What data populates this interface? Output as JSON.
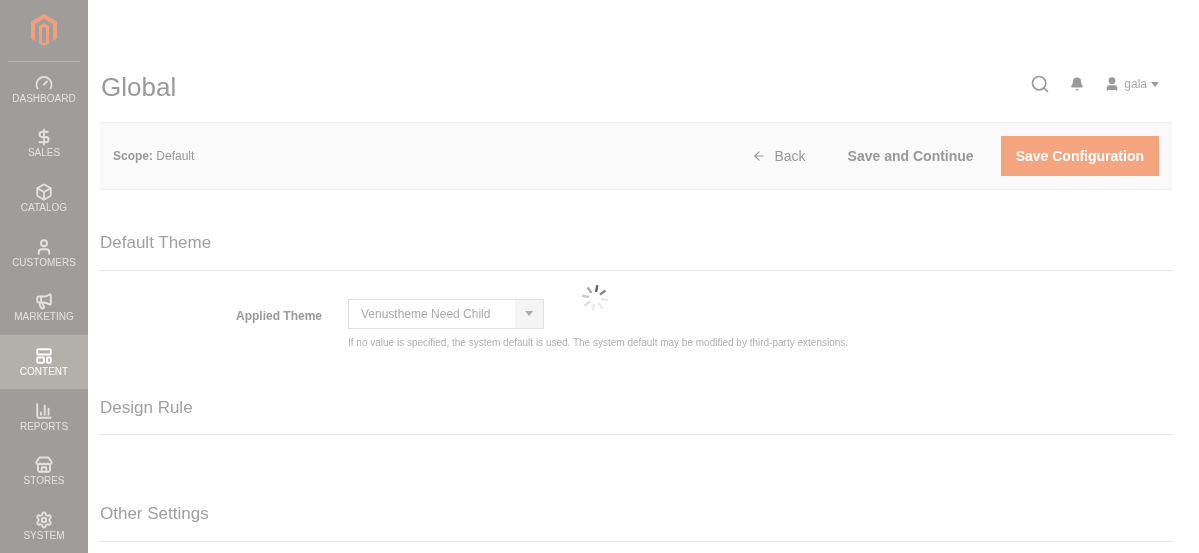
{
  "sidebar": {
    "items": [
      {
        "label": "DASHBOARD",
        "selected": false
      },
      {
        "label": "SALES",
        "selected": false
      },
      {
        "label": "CATALOG",
        "selected": false
      },
      {
        "label": "CUSTOMERS",
        "selected": false
      },
      {
        "label": "MARKETING",
        "selected": false
      },
      {
        "label": "CONTENT",
        "selected": true
      },
      {
        "label": "REPORTS",
        "selected": false
      },
      {
        "label": "STORES",
        "selected": false
      },
      {
        "label": "SYSTEM",
        "selected": false
      }
    ]
  },
  "header": {
    "title": "Global",
    "user": "gala"
  },
  "toolbar": {
    "scope": "**Scope:** Default",
    "back": "Back",
    "save_continue": "Save and Continue",
    "save": "Save Configuration"
  },
  "sections": [
    {
      "title": "Default Theme",
      "fields": [
        {
          "label": "Applied Theme",
          "value": "Venustheme Need Child",
          "note": "If no value is specified, the system default is used. The system default may be modified by third-party extensions."
        }
      ]
    },
    {
      "title": "Design Rule"
    },
    {
      "title": "Other Settings"
    }
  ],
  "loading": true
}
